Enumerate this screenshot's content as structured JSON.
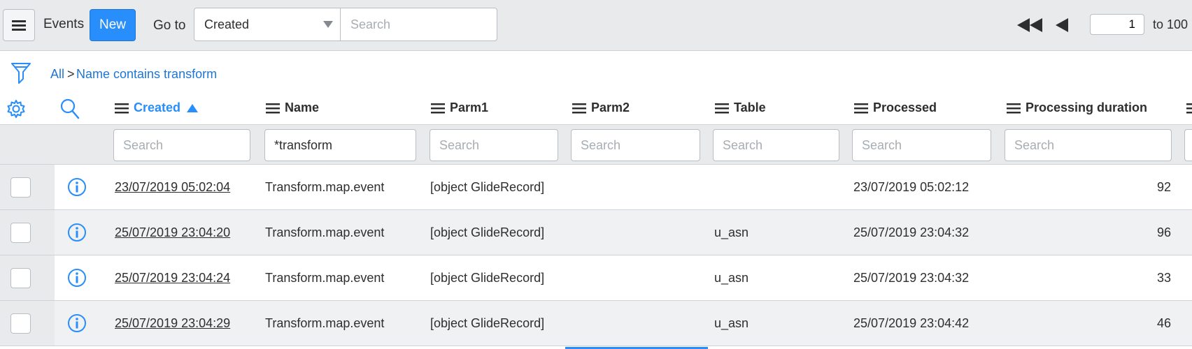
{
  "toolbar": {
    "title": "Events",
    "new_label": "New",
    "goto_label": "Go to",
    "goto_field": "Created",
    "search_placeholder": "Search",
    "page_value": "1",
    "range_label": "to 100"
  },
  "breadcrumb": {
    "all": "All",
    "separator": ">",
    "condition": "Name contains transform"
  },
  "columns": [
    {
      "label": "Created",
      "sorted": "ascending"
    },
    {
      "label": "Name"
    },
    {
      "label": "Parm1"
    },
    {
      "label": "Parm2"
    },
    {
      "label": "Table"
    },
    {
      "label": "Processed"
    },
    {
      "label": "Processing duration"
    }
  ],
  "column_search": {
    "placeholder": "Search",
    "name_value": "*transform"
  },
  "rows": [
    {
      "created": "23/07/2019 05:02:04",
      "name": "Transform.map.event",
      "parm1": "[object GlideRecord]",
      "parm2": "",
      "table": "",
      "processed": "23/07/2019 05:02:12",
      "duration": "92"
    },
    {
      "created": "25/07/2019 23:04:20",
      "name": "Transform.map.event",
      "parm1": "[object GlideRecord]",
      "parm2": "",
      "table": "u_asn",
      "processed": "25/07/2019 23:04:32",
      "duration": "96"
    },
    {
      "created": "25/07/2019 23:04:24",
      "name": "Transform.map.event",
      "parm1": "[object GlideRecord]",
      "parm2": "",
      "table": "u_asn",
      "processed": "25/07/2019 23:04:32",
      "duration": "33"
    },
    {
      "created": "25/07/2019 23:04:29",
      "name": "Transform.map.event",
      "parm1": "[object GlideRecord]",
      "parm2": "",
      "table": "u_asn",
      "processed": "25/07/2019 23:04:42",
      "duration": "46"
    }
  ],
  "colors": {
    "accent": "#278efc",
    "link": "#1f76d2",
    "toolbar_bg": "#e9eaec"
  }
}
